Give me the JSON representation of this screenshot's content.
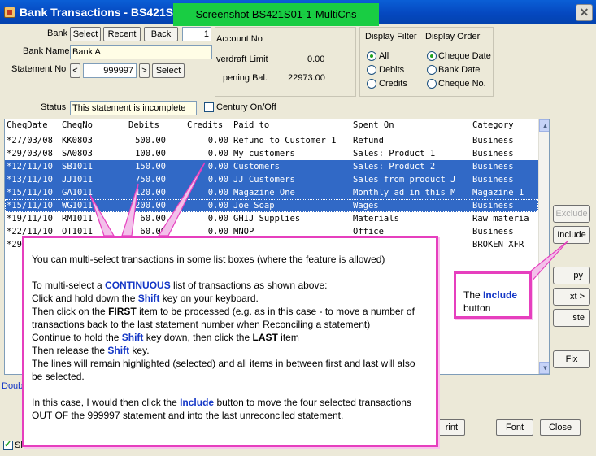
{
  "window": {
    "title": "Bank Transactions  -  BS421S01",
    "banner": "Screenshot BS421S01-1-MultiCns",
    "close_glyph": "✕",
    "icon": "app-icon"
  },
  "bank": {
    "label": "Bank",
    "select_btn": "Select",
    "recent_btn": "Recent",
    "back_btn": "Back",
    "number": "1",
    "name_label": "Bank Name",
    "name_value": "Bank A"
  },
  "statement": {
    "label": "Statement No",
    "prev_btn": "<",
    "value": "999997",
    "next_btn": ">",
    "select_btn": "Select"
  },
  "account": {
    "account_no_label": "Account No",
    "overdraft_label": "verdraft Limit",
    "overdraft_value": "0.00",
    "opening_label": "pening Bal.",
    "opening_value": "22973.00"
  },
  "display_filter": {
    "title": "Display Filter",
    "options": [
      "All",
      "Debits",
      "Credits"
    ],
    "selected": "All"
  },
  "display_order": {
    "title": "Display Order",
    "options": [
      "Cheque Date",
      "Bank Date",
      "Cheque No."
    ],
    "selected": "Cheque Date"
  },
  "status": {
    "label": "Status",
    "value": "This statement is incomplete",
    "century_label": "Century On/Off"
  },
  "list": {
    "headers": [
      "CheqDate",
      "CheqNo",
      "Debits",
      "Credits",
      "Paid to",
      "Spent On",
      "Category"
    ],
    "rows": [
      {
        "date": "*27/03/08",
        "no": "KK0803",
        "debit": "500.00",
        "credit": "0.00",
        "paid": "Refund to Customer 1",
        "spent": "Refund",
        "cat": "Business",
        "sel": false
      },
      {
        "date": "*29/03/08",
        "no": "SA0803",
        "debit": "100.00",
        "credit": "0.00",
        "paid": "My customers",
        "spent": "Sales: Product 1",
        "cat": "Business",
        "sel": false
      },
      {
        "date": "*12/11/10",
        "no": "SB1011",
        "debit": "150.00",
        "credit": "0.00",
        "paid": "Customers",
        "spent": "Sales: Product 2",
        "cat": "Business",
        "sel": true
      },
      {
        "date": "*13/11/10",
        "no": "JJ1011",
        "debit": "750.00",
        "credit": "0.00",
        "paid": "JJ Customers",
        "spent": "Sales from product J",
        "cat": "Business",
        "sel": true
      },
      {
        "date": "*15/11/10",
        "no": "GA1011",
        "debit": "120.00",
        "credit": "0.00",
        "paid": "Magazine One",
        "spent": "Monthly ad in this M",
        "cat": "Magazine 1",
        "sel": true
      },
      {
        "date": "*15/11/10",
        "no": "WG1011",
        "debit": "1200.00",
        "credit": "0.00",
        "paid": "Joe Soap",
        "spent": "Wages",
        "cat": "Business",
        "sel": true
      },
      {
        "date": "*19/11/10",
        "no": "RM1011",
        "debit": "60.00",
        "credit": "0.00",
        "paid": "GHIJ Supplies",
        "spent": "Materials",
        "cat": "Raw materia",
        "sel": false
      },
      {
        "date": "*22/11/10",
        "no": "OT1011",
        "debit": "60.00",
        "credit": "0.00",
        "paid": "MNOP",
        "spent": "Office",
        "cat": "Business",
        "sel": false
      },
      {
        "date": "*29",
        "no": "",
        "debit": "",
        "credit": "",
        "paid": "",
        "spent": "",
        "cat": "BROKEN XFR",
        "sel": false
      }
    ]
  },
  "side_buttons": {
    "exclude": "Exclude",
    "include": "Include",
    "copy": "py",
    "next": "xt >",
    "paste": "ste",
    "fix": "Fix"
  },
  "bottom": {
    "doub_text": "Doub",
    "print_btn": "rint",
    "font_btn": "Font",
    "close_btn": "Close",
    "show_label": "Sh"
  },
  "callout_main": {
    "l1": "You can multi-select transactions in some list boxes (where the feature is allowed)",
    "l2a": "To multi-select a ",
    "l2b": "CONTINUOUS",
    "l2c": " list of transactions as shown above:",
    "l3a": "Click and hold down the ",
    "l3b": "Shift",
    "l3c": " key on your keyboard.",
    "l4a": "Then click on the ",
    "l4b": "FIRST",
    "l4c": " item to be processed (e.g. as in this case - to move a number of transactions back to the last statement number when Reconciling a statement)",
    "l5a": "Continue to hold the ",
    "l5b": "Shift",
    "l5c": " key down, then click the ",
    "l5d": "LAST",
    "l5e": " item",
    "l6a": "Then release the ",
    "l6b": "Shift",
    "l6c": " key.",
    "l7": "The lines will remain highlighted (selected) and all items in between first and last will also be selected.",
    "l8a": "In this case, I would then click the ",
    "l8b": "Include",
    "l8c": " button to move the four selected transactions OUT OF the 999997 statement and into the last unreconciled statement."
  },
  "callout_include": {
    "a": "The ",
    "b": "Include",
    "c": " button"
  },
  "colors": {
    "accent_pink": "#e63fbe",
    "selection_blue": "#3169c6",
    "highlight_text": "#1336c6",
    "banner_green": "#19cd43",
    "titlebar_blue": "#0548c0"
  }
}
